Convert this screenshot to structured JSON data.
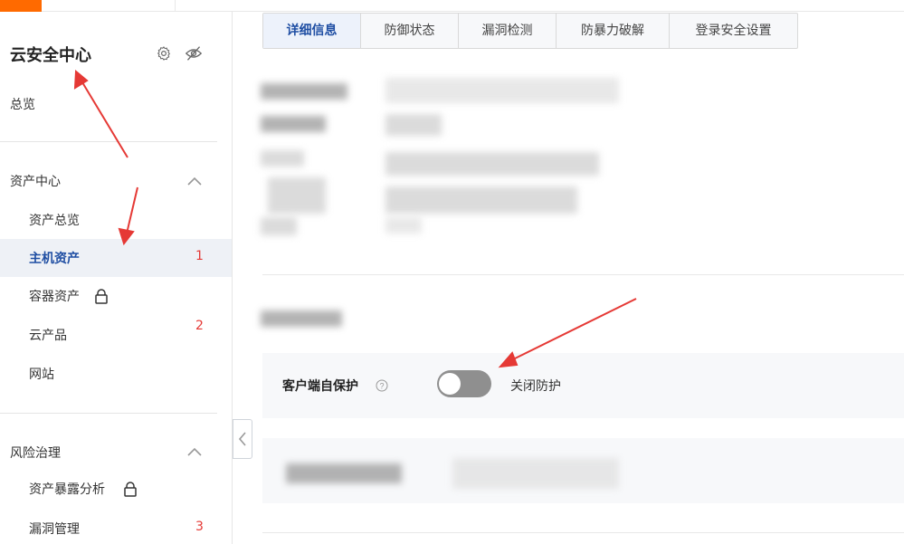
{
  "sidebar": {
    "title": "云安全中心",
    "overview": "总览",
    "groups": [
      {
        "label": "资产中心",
        "items": [
          {
            "label": "资产总览",
            "count": ""
          },
          {
            "label": "主机资产",
            "count": "1"
          },
          {
            "label": "容器资产",
            "count": ""
          },
          {
            "label": "云产品",
            "count": "2"
          },
          {
            "label": "网站",
            "count": ""
          }
        ]
      },
      {
        "label": "风险治理",
        "items": [
          {
            "label": "资产暴露分析",
            "count": ""
          },
          {
            "label": "漏洞管理",
            "count": "3"
          }
        ]
      }
    ]
  },
  "tabs": [
    "详细信息",
    "防御状态",
    "漏洞检测",
    "防暴力破解",
    "登录安全设置"
  ],
  "detail_rows": [
    "客户端状态",
    "操作系统",
    "CPU",
    "",
    "内存"
  ],
  "defense": {
    "heading": "防御状态",
    "self_protect_label": "客户端自保护",
    "toggle_text": "关闭防护",
    "toggle_state": "off",
    "network_label": "恶意网络行为防"
  },
  "colors": {
    "accent": "#1f4ea3",
    "count_red": "#e53935",
    "arrow_red": "#e53935",
    "logo_orange": "#ff6a00"
  }
}
